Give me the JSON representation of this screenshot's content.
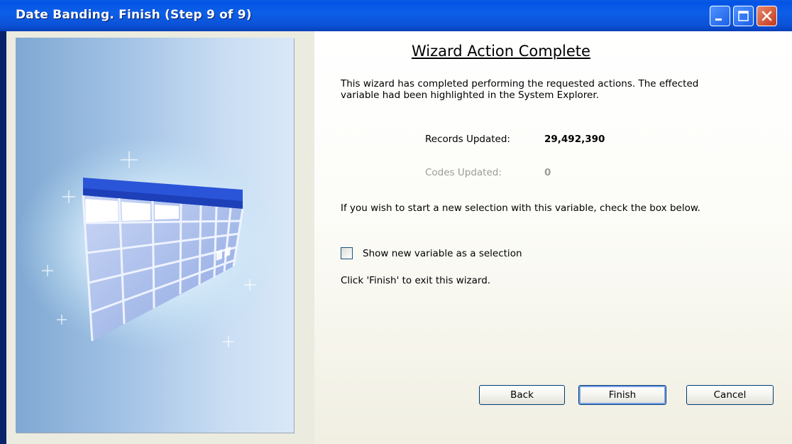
{
  "window": {
    "title": "Date Banding.  Finish (Step 9 of 9)"
  },
  "titlebar_buttons": {
    "minimize": "minimize-icon",
    "maximize": "maximize-icon",
    "close": "close-icon"
  },
  "content": {
    "heading": "Wizard Action Complete",
    "intro": "This wizard has completed performing the requested actions. The effected variable had been highlighted in the System Explorer.",
    "records_label": "Records Updated:",
    "records_value": "29,492,390",
    "codes_label": "Codes Updated:",
    "codes_value": "0",
    "selection_prompt": "If you wish to start a new selection with this variable, check the box below.",
    "checkbox_label": "Show new variable as a selection",
    "checkbox_checked": false,
    "finish_hint": "Click 'Finish' to exit this wizard."
  },
  "buttons": {
    "back": "Back",
    "finish": "Finish",
    "cancel": "Cancel"
  },
  "colors": {
    "title_bar": "#0a5ae0",
    "sidebar": "#a4c3e6",
    "table_header": "#2a55d8"
  }
}
